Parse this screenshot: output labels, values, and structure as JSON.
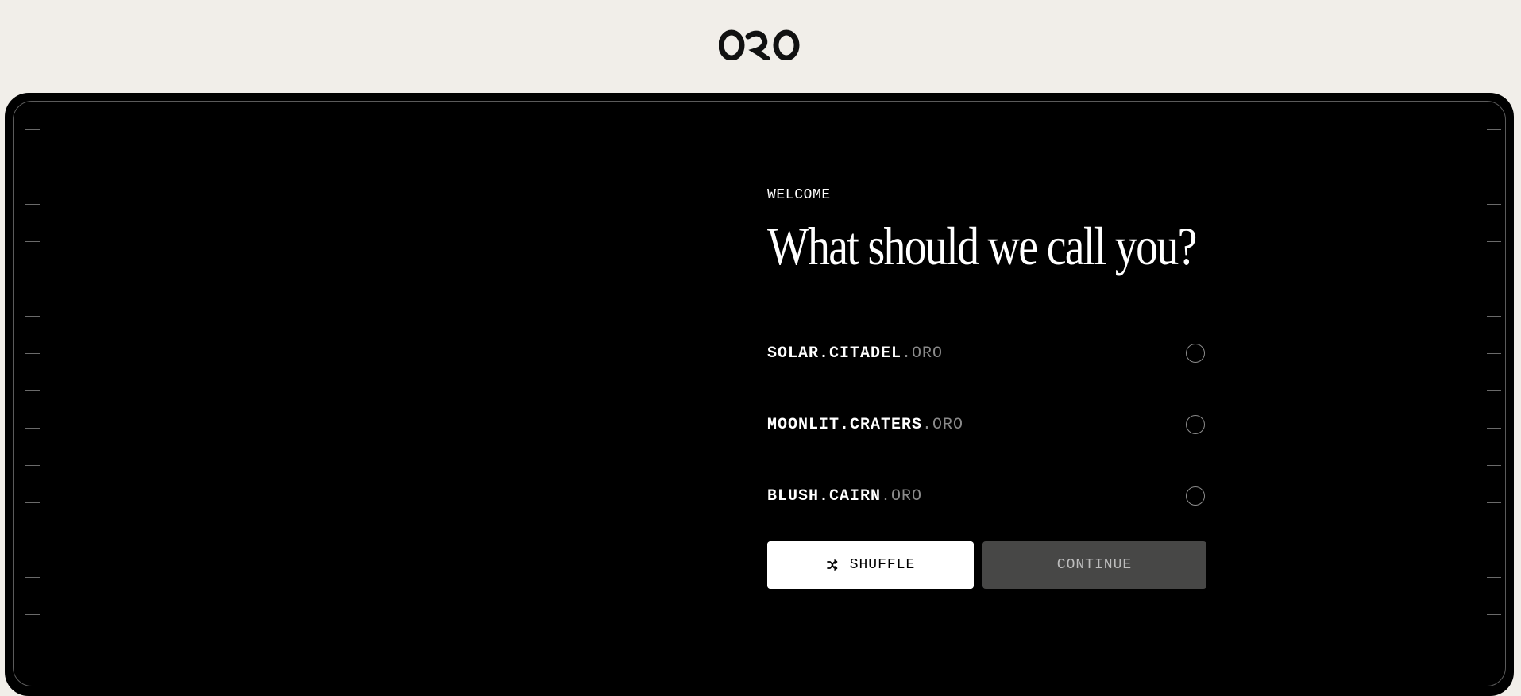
{
  "brand": {
    "logo_text": "ORO"
  },
  "welcome": {
    "eyebrow": "WELCOME",
    "heading": "What should we call you?"
  },
  "options": [
    {
      "name": "SOLAR.CITADEL",
      "suffix": ".ORO",
      "selected": false
    },
    {
      "name": "MOONLIT.CRATERS",
      "suffix": ".ORO",
      "selected": false
    },
    {
      "name": "BLUSH.CAIRN",
      "suffix": ".ORO",
      "selected": false
    }
  ],
  "actions": {
    "shuffle_label": "SHUFFLE",
    "shuffle_icon": "shuffle-icon",
    "continue_label": "CONTINUE"
  },
  "colors": {
    "page_background": "#f1eee9",
    "panel_background": "#000000",
    "primary_text": "#ffffff",
    "muted_suffix": "#8a8a8a",
    "disabled_button": "#474746"
  }
}
